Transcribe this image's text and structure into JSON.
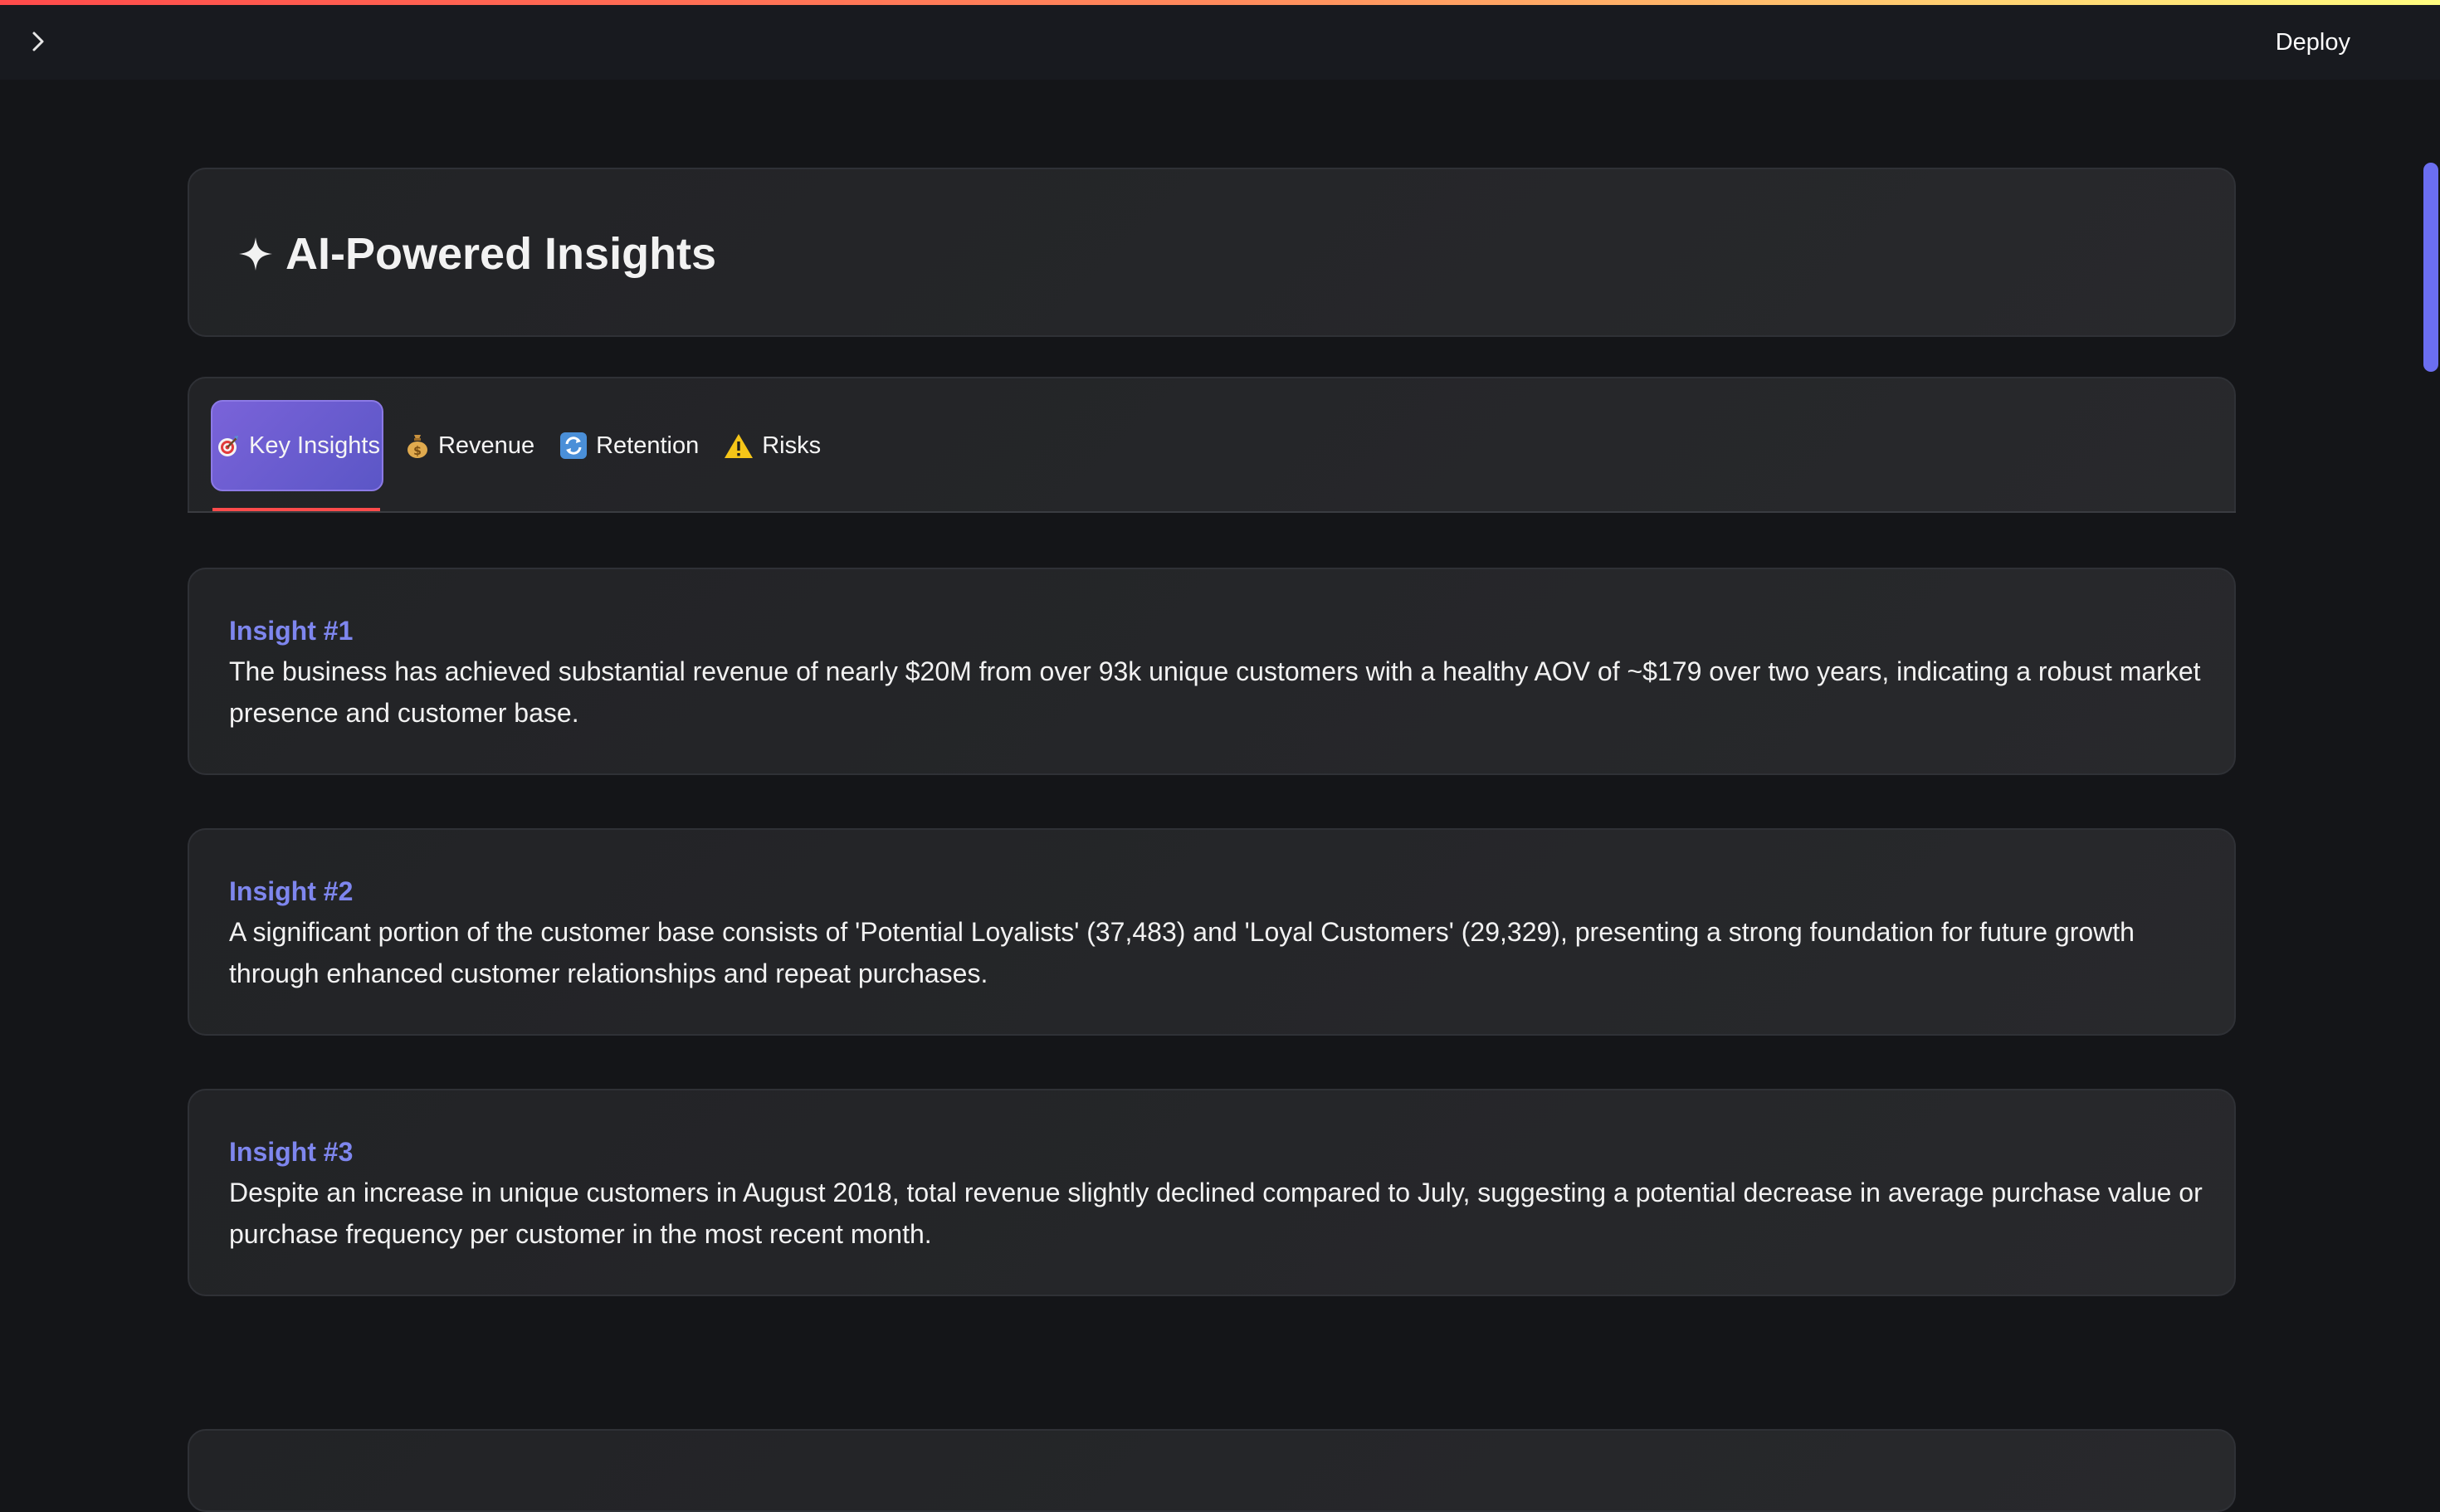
{
  "topbar": {
    "sidebar_toggle_icon": "chevron-right-icon",
    "deploy_label": "Deploy",
    "accent_gradient": [
      "#ff4b4b",
      "#fffd80"
    ]
  },
  "header": {
    "icon": "sparkle-icon",
    "title": "AI-Powered Insights"
  },
  "tabs": [
    {
      "label": "Key Insights",
      "icon": "target-icon",
      "active": true
    },
    {
      "label": "Revenue",
      "icon": "money-bag-icon",
      "active": false
    },
    {
      "label": "Retention",
      "icon": "refresh-icon",
      "active": false
    },
    {
      "label": "Risks",
      "icon": "warning-icon",
      "active": false
    }
  ],
  "insights": [
    {
      "title": "Insight #1",
      "text": "The business has achieved substantial revenue of nearly $20M from over 93k unique customers with a healthy AOV of ~$179 over two years, indicating a robust market presence and customer base."
    },
    {
      "title": "Insight #2",
      "text": "A significant portion of the customer base consists of 'Potential Loyalists' (37,483) and 'Loyal Customers' (29,329), presenting a strong foundation for future growth through enhanced customer relationships and repeat purchases."
    },
    {
      "title": "Insight #3",
      "text": "Despite an increase in unique customers in August 2018, total revenue slightly declined compared to July, suggesting a potential decrease in average purchase value or purchase frequency per customer in the most recent month."
    }
  ],
  "colors": {
    "background": "#141518",
    "accent": "#7e86ee",
    "active_tab": "#6b5dd3",
    "tab_underline": "#ff4b4b"
  }
}
